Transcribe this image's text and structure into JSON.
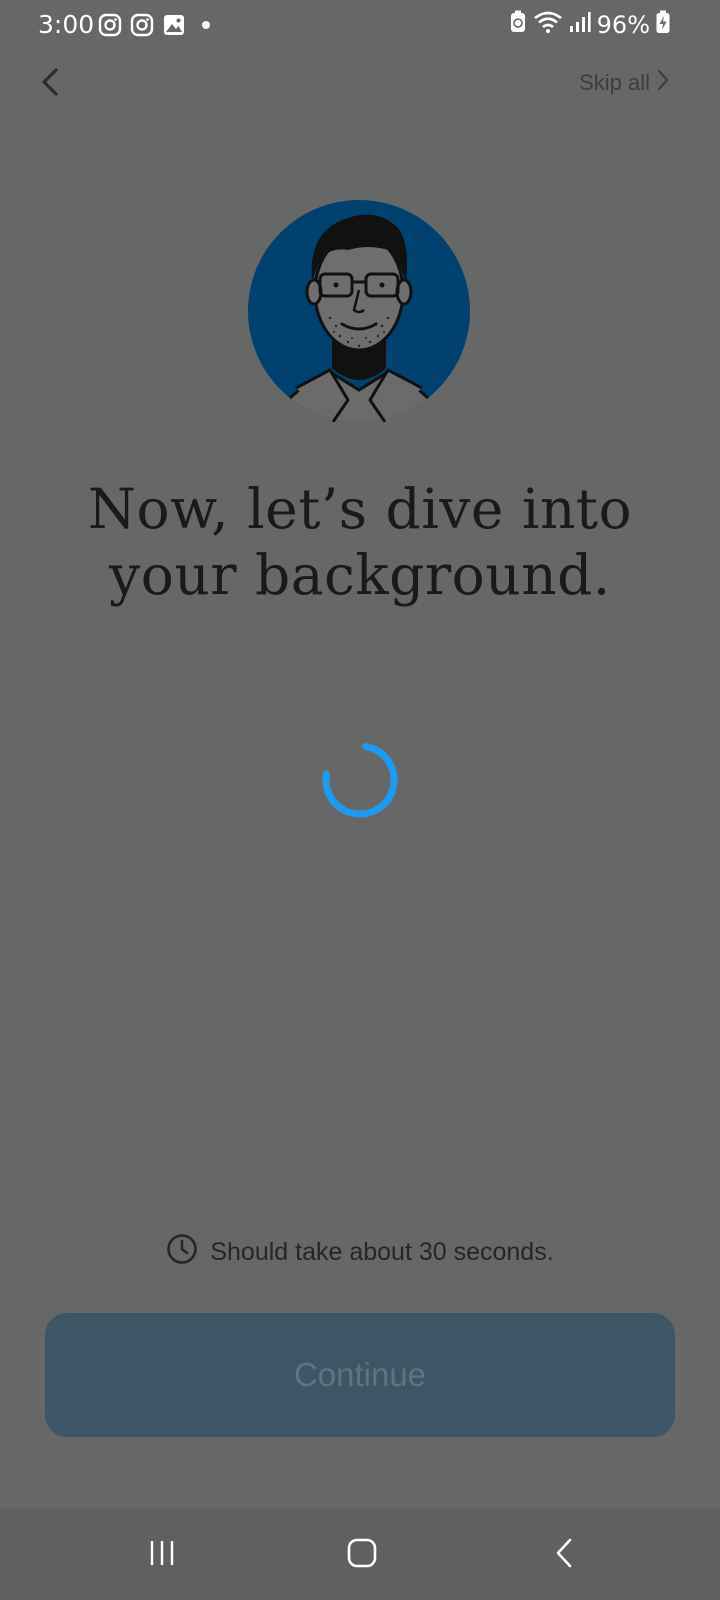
{
  "status_bar": {
    "time": "3:00",
    "battery": "96%",
    "left_icons": [
      "instagram-icon",
      "instagram-icon",
      "gallery-icon",
      "dot-icon"
    ],
    "right_icons": [
      "battery-saver-icon",
      "wifi-icon",
      "signal-icon",
      "battery-charging-icon"
    ]
  },
  "nav": {
    "back_icon": "chevron-left-icon",
    "skip_label": "Skip all",
    "skip_icon": "chevron-right-icon"
  },
  "main": {
    "heading": "Now, let’s dive into your background.",
    "avatar_icon": "illustrated-man-avatar",
    "spinner_color": "#1e9bf0"
  },
  "footer": {
    "info_icon": "clock-icon",
    "info_text": "Should take about 30 seconds.",
    "continue_label": "Continue",
    "continue_bg": "#3d5565"
  },
  "system_nav": {
    "items": [
      "recent-apps-icon",
      "home-icon",
      "back-icon"
    ]
  },
  "colors": {
    "background": "#666767",
    "avatar_bg": "#00416f"
  }
}
